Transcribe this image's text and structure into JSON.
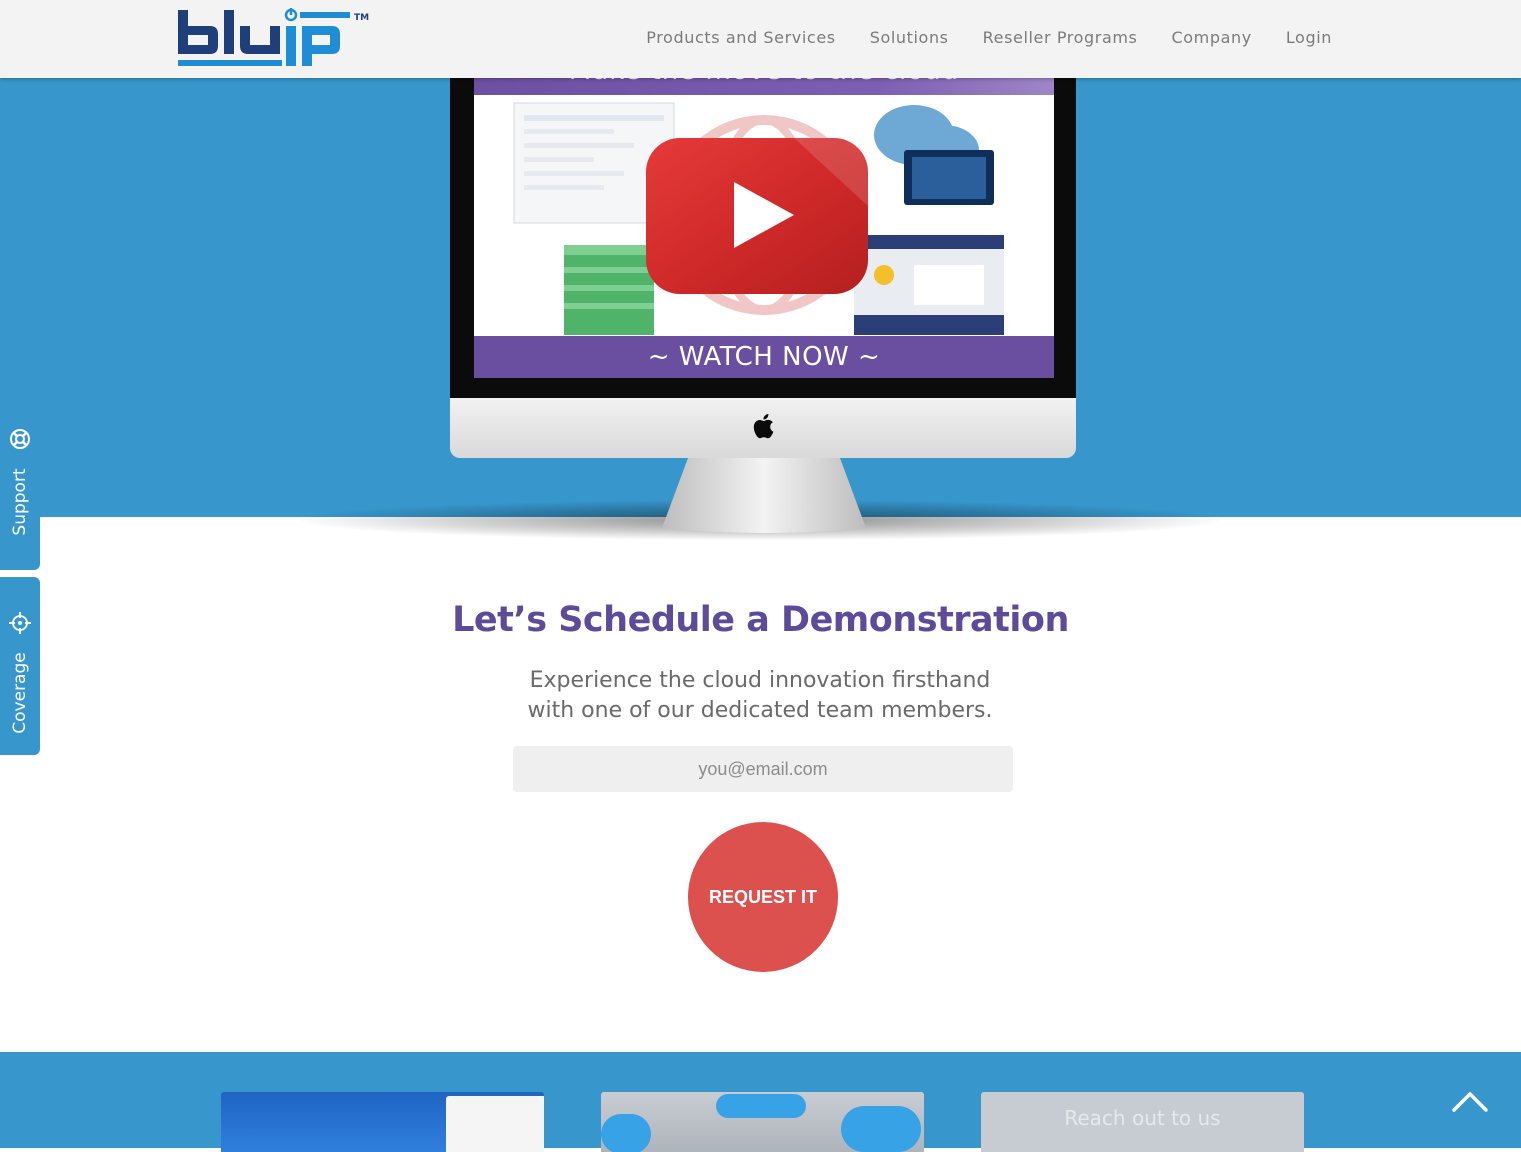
{
  "header": {
    "logo_text": "bluip",
    "logo_tm": "TM",
    "nav": [
      {
        "label": "Products and Services"
      },
      {
        "label": "Solutions"
      },
      {
        "label": "Reseller Programs"
      },
      {
        "label": "Company"
      },
      {
        "label": "Login"
      }
    ]
  },
  "hero": {
    "screen_top_text": "Make the move to the cloud",
    "watch_label": "~ WATCH NOW ~",
    "play_icon": "play-icon"
  },
  "side_tabs": [
    {
      "label": "Support",
      "icon": "lifebuoy-icon"
    },
    {
      "label": "Coverage",
      "icon": "crosshair-icon"
    }
  ],
  "demo": {
    "title": "Let’s Schedule a Demonstration",
    "subtitle_line1": "Experience the cloud innovation firsthand",
    "subtitle_line2": "with one of our dedicated team members.",
    "email_placeholder": "you@email.com",
    "button_label": "REQUEST IT"
  },
  "bottom": {
    "card3_text": "Reach out to us",
    "scroll_top_icon": "chevron-up-icon"
  },
  "colors": {
    "brand_blue": "#3796cb",
    "logo_navy": "#1f3f7a",
    "logo_cyan": "#1f8dd6",
    "purple": "#5d4b9a",
    "button_red": "#dc504d",
    "yt_red": "#d92b2b"
  }
}
